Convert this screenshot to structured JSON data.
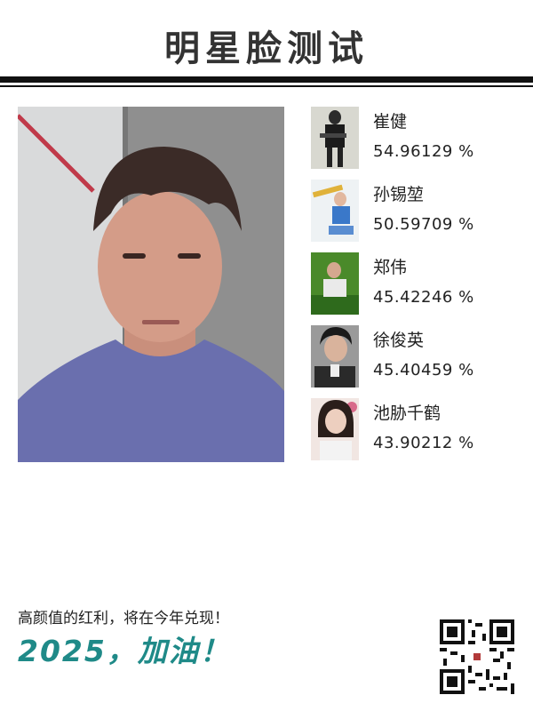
{
  "header": {
    "title": "明星脸测试"
  },
  "main_photo": {
    "description_icon": "user-photo"
  },
  "results": [
    {
      "name": "崔健",
      "score": "54.96129 %"
    },
    {
      "name": "孙锡堃",
      "score": "50.59709 %"
    },
    {
      "name": "郑伟",
      "score": "45.42246 %"
    },
    {
      "name": "徐俊英",
      "score": "45.40459 %"
    },
    {
      "name": "池胁千鹤",
      "score": "43.90212 %"
    }
  ],
  "footer": {
    "slogan": "高颜值的红利，将在今年兑现！",
    "cheer": "2025，加油！",
    "qr_icon": "qr-code-icon"
  },
  "colors": {
    "accent": "#1f8a88",
    "rule": "#111111",
    "title": "#333333"
  }
}
